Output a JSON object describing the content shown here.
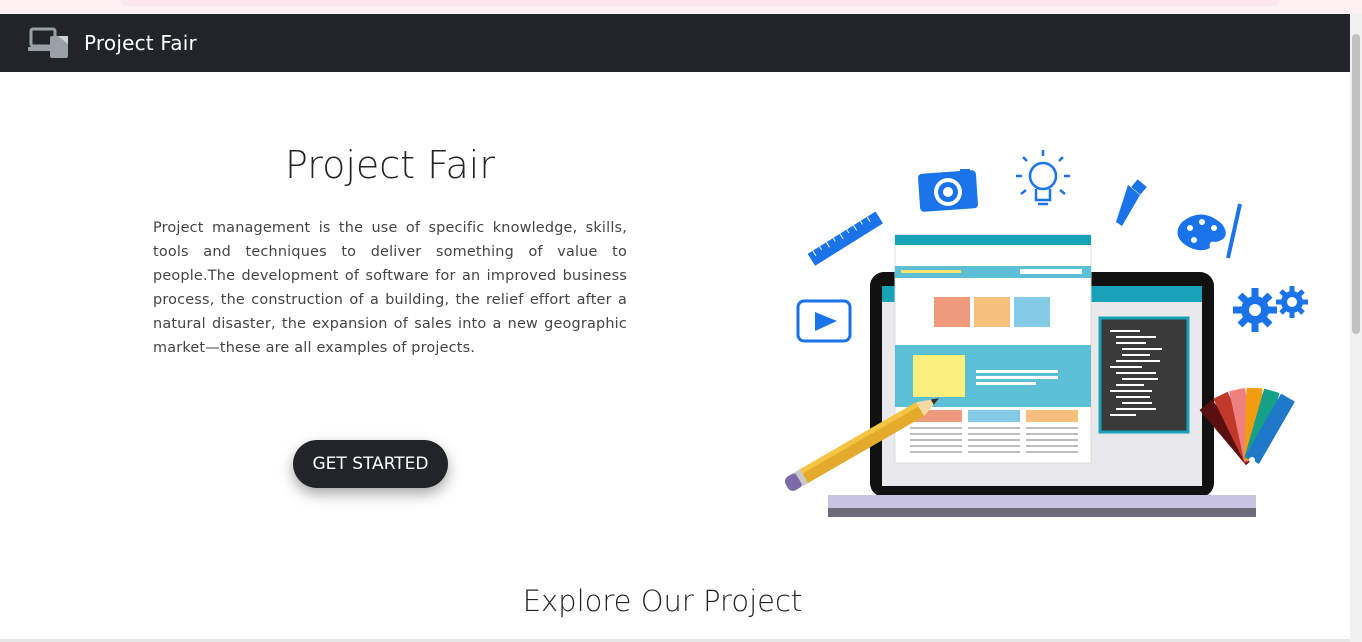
{
  "navbar": {
    "brand": "Project Fair",
    "brand_icon": "devices-icon"
  },
  "hero": {
    "title": "Project Fair",
    "description": "Project management is the use of specific knowledge, skills, tools and techniques to deliver something of value to people.The development of software for an improved business process, the construction of a building, the relief effort after a natural disaster, the expansion of sales into a new geographic market—these are all examples of projects.",
    "cta_label": "GET STARTED"
  },
  "section": {
    "title": "Explore Our Project"
  },
  "colors": {
    "navbar_bg": "#212529",
    "accent_blue": "#1a73e8",
    "teal": "#17a2b8"
  }
}
